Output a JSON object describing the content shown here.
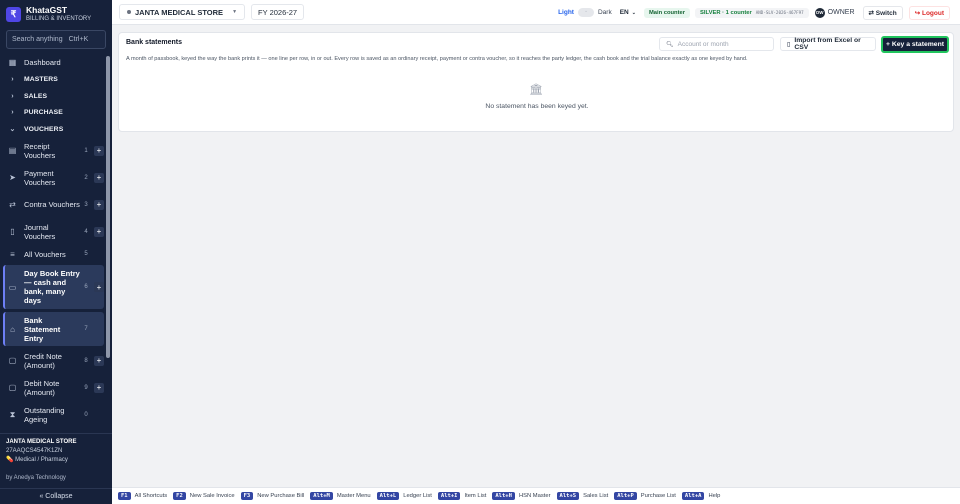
{
  "brand": {
    "logo_letter": "₹",
    "name": "KhataGST",
    "subtitle": "BILLING & INVENTORY"
  },
  "search": {
    "placeholder": "Search anything",
    "shortcut": "Ctrl+K"
  },
  "sidebar": {
    "items": [
      {
        "label": "Dashboard",
        "icon": "grid-icon"
      },
      {
        "label": "MASTERS",
        "icon": "chevron-right-icon"
      },
      {
        "label": "SALES",
        "icon": "chevron-right-icon"
      },
      {
        "label": "PURCHASE",
        "icon": "chevron-right-icon"
      },
      {
        "label": "VOUCHERS",
        "icon": "chevron-down-icon"
      },
      {
        "label": "Receipt Vouchers",
        "key": "1",
        "icon": "receipt-icon"
      },
      {
        "label": "Payment Vouchers",
        "key": "2",
        "icon": "send-icon"
      },
      {
        "label": "Contra Vouchers",
        "key": "3",
        "icon": "swap-icon"
      },
      {
        "label": "Journal Vouchers",
        "key": "4",
        "icon": "book-icon"
      },
      {
        "label": "All Vouchers",
        "key": "5",
        "icon": "list-icon"
      },
      {
        "label": "Day Book Entry — cash and bank, many days",
        "key": "6",
        "icon": "book-open-icon"
      },
      {
        "label": "Bank Statement Entry",
        "key": "7",
        "icon": "bank-icon"
      },
      {
        "label": "Credit Note (Amount)",
        "key": "8",
        "icon": "document-icon"
      },
      {
        "label": "Debit Note (Amount)",
        "key": "9",
        "icon": "document-icon"
      },
      {
        "label": "Outstanding Ageing",
        "key": "0",
        "icon": "hourglass-icon"
      }
    ],
    "plus_label": "+",
    "footer": {
      "store_name": "JANTA MEDICAL STORE",
      "gstin": "27AAQCS4547K1ZN",
      "type": "Medical / Pharmacy",
      "by": "by Anedya Technology",
      "collapse": "« Collapse"
    }
  },
  "topbar": {
    "store": "JANTA MEDICAL STORE",
    "fy": "FY 2026-27",
    "theme_light": "Light",
    "theme_dark": "Dark",
    "lang": "EN",
    "main_counter": "Main counter",
    "plan": "SILVER · 1 counter",
    "plan_code": "AND-SLV-2026-467F97",
    "avatar": "OW",
    "role": "OWNER",
    "switch": "⇄ Switch",
    "logout": "↪ Logout"
  },
  "panel": {
    "title": "Bank statements",
    "search_placeholder": "Account or month",
    "import_label": "Import from Excel or CSV",
    "primary_label": "+ Key a statement",
    "description": "A month of passbook, keyed the way the bank prints it — one line per row, in or out. Every row is saved as an ordinary receipt, payment or contra voucher, so it reaches the party ledger, the cash book and the trial balance exactly as one keyed by hand.",
    "empty_text": "No statement has been keyed yet."
  },
  "shortcuts": [
    {
      "key": "F1",
      "label": "All Shortcuts"
    },
    {
      "key": "F2",
      "label": "New Sale Invoice"
    },
    {
      "key": "F3",
      "label": "New Purchase Bill"
    },
    {
      "key": "Alt+M",
      "label": "Master Menu"
    },
    {
      "key": "Alt+L",
      "label": "Ledger List"
    },
    {
      "key": "Alt+I",
      "label": "Item List"
    },
    {
      "key": "Alt+H",
      "label": "HSN Master"
    },
    {
      "key": "Alt+S",
      "label": "Sales List"
    },
    {
      "key": "Alt+P",
      "label": "Purchase List"
    },
    {
      "key": "Alt+A",
      "label": "Help"
    }
  ],
  "colors": {
    "sidebar_bg": "#16213a",
    "accent": "#22c55e",
    "primary": "#16213a",
    "kbd": "#3346a3"
  }
}
